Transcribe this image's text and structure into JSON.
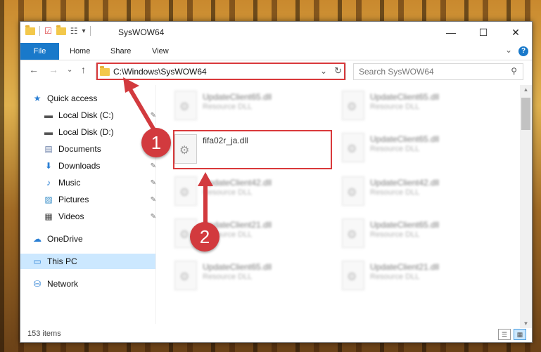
{
  "window": {
    "title": "SysWOW64",
    "minimize_glyph": "—",
    "maximize_glyph": "☐",
    "close_glyph": "✕"
  },
  "ribbon": {
    "tabs": [
      "File",
      "Home",
      "Share",
      "View"
    ],
    "expand_glyph": "⌄",
    "help_glyph": "?"
  },
  "address_bar": {
    "path": "C:\\Windows\\SysWOW64",
    "dropdown_glyph": "⌄",
    "refresh_glyph": "↻"
  },
  "search": {
    "placeholder": "Search SysWOW64",
    "icon": "search-icon"
  },
  "nav": {
    "back_glyph": "←",
    "forward_glyph": "→",
    "recent_glyph": "⌄",
    "up_glyph": "↑"
  },
  "sidebar": {
    "items": [
      {
        "label": "Quick access",
        "icon": "star-icon",
        "glyph": "★",
        "pinned": false
      },
      {
        "label": "Local Disk (C:)",
        "icon": "drive-icon",
        "glyph": "▬",
        "pinned": true
      },
      {
        "label": "Local Disk (D:)",
        "icon": "drive-icon",
        "glyph": "▬",
        "pinned": true
      },
      {
        "label": "Documents",
        "icon": "documents-icon",
        "glyph": "▤",
        "pinned": true
      },
      {
        "label": "Downloads",
        "icon": "downloads-icon",
        "glyph": "⬇",
        "pinned": true
      },
      {
        "label": "Music",
        "icon": "music-icon",
        "glyph": "♪",
        "pinned": true
      },
      {
        "label": "Pictures",
        "icon": "pictures-icon",
        "glyph": "▨",
        "pinned": true
      },
      {
        "label": "Videos",
        "icon": "videos-icon",
        "glyph": "▦",
        "pinned": true
      },
      {
        "label": "OneDrive",
        "icon": "cloud-icon",
        "glyph": "☁",
        "pinned": false
      },
      {
        "label": "This PC",
        "icon": "computer-icon",
        "glyph": "▭",
        "pinned": false
      },
      {
        "label": "Network",
        "icon": "network-icon",
        "glyph": "⛁",
        "pinned": false
      }
    ],
    "pin_glyph": "📌"
  },
  "files": {
    "highlighted": {
      "name": "fifa02r_ja.dll",
      "type": ""
    },
    "blurred": [
      {
        "name": "UpdateClient65.dll",
        "type": "Resource DLL"
      },
      {
        "name": "UpdateClient65.dll",
        "type": "Resource DLL"
      },
      {
        "name": "UpdateClient65.dll",
        "type": "Resource DLL"
      },
      {
        "name": "UpdateClient42.dll",
        "type": "Resource DLL"
      },
      {
        "name": "UpdateClient42.dll",
        "type": "Resource DLL"
      },
      {
        "name": "UpdateClient21.dll",
        "type": "Resource DLL"
      },
      {
        "name": "UpdateClient65.dll",
        "type": "Resource DLL"
      },
      {
        "name": "UpdateClient65.dll",
        "type": "Resource DLL"
      },
      {
        "name": "UpdateClient21.dll",
        "type": "Resource DLL"
      }
    ]
  },
  "status": {
    "item_count": "153 items"
  },
  "annotations": {
    "marker1": "1",
    "marker2": "2",
    "color": "#d23a3e"
  }
}
